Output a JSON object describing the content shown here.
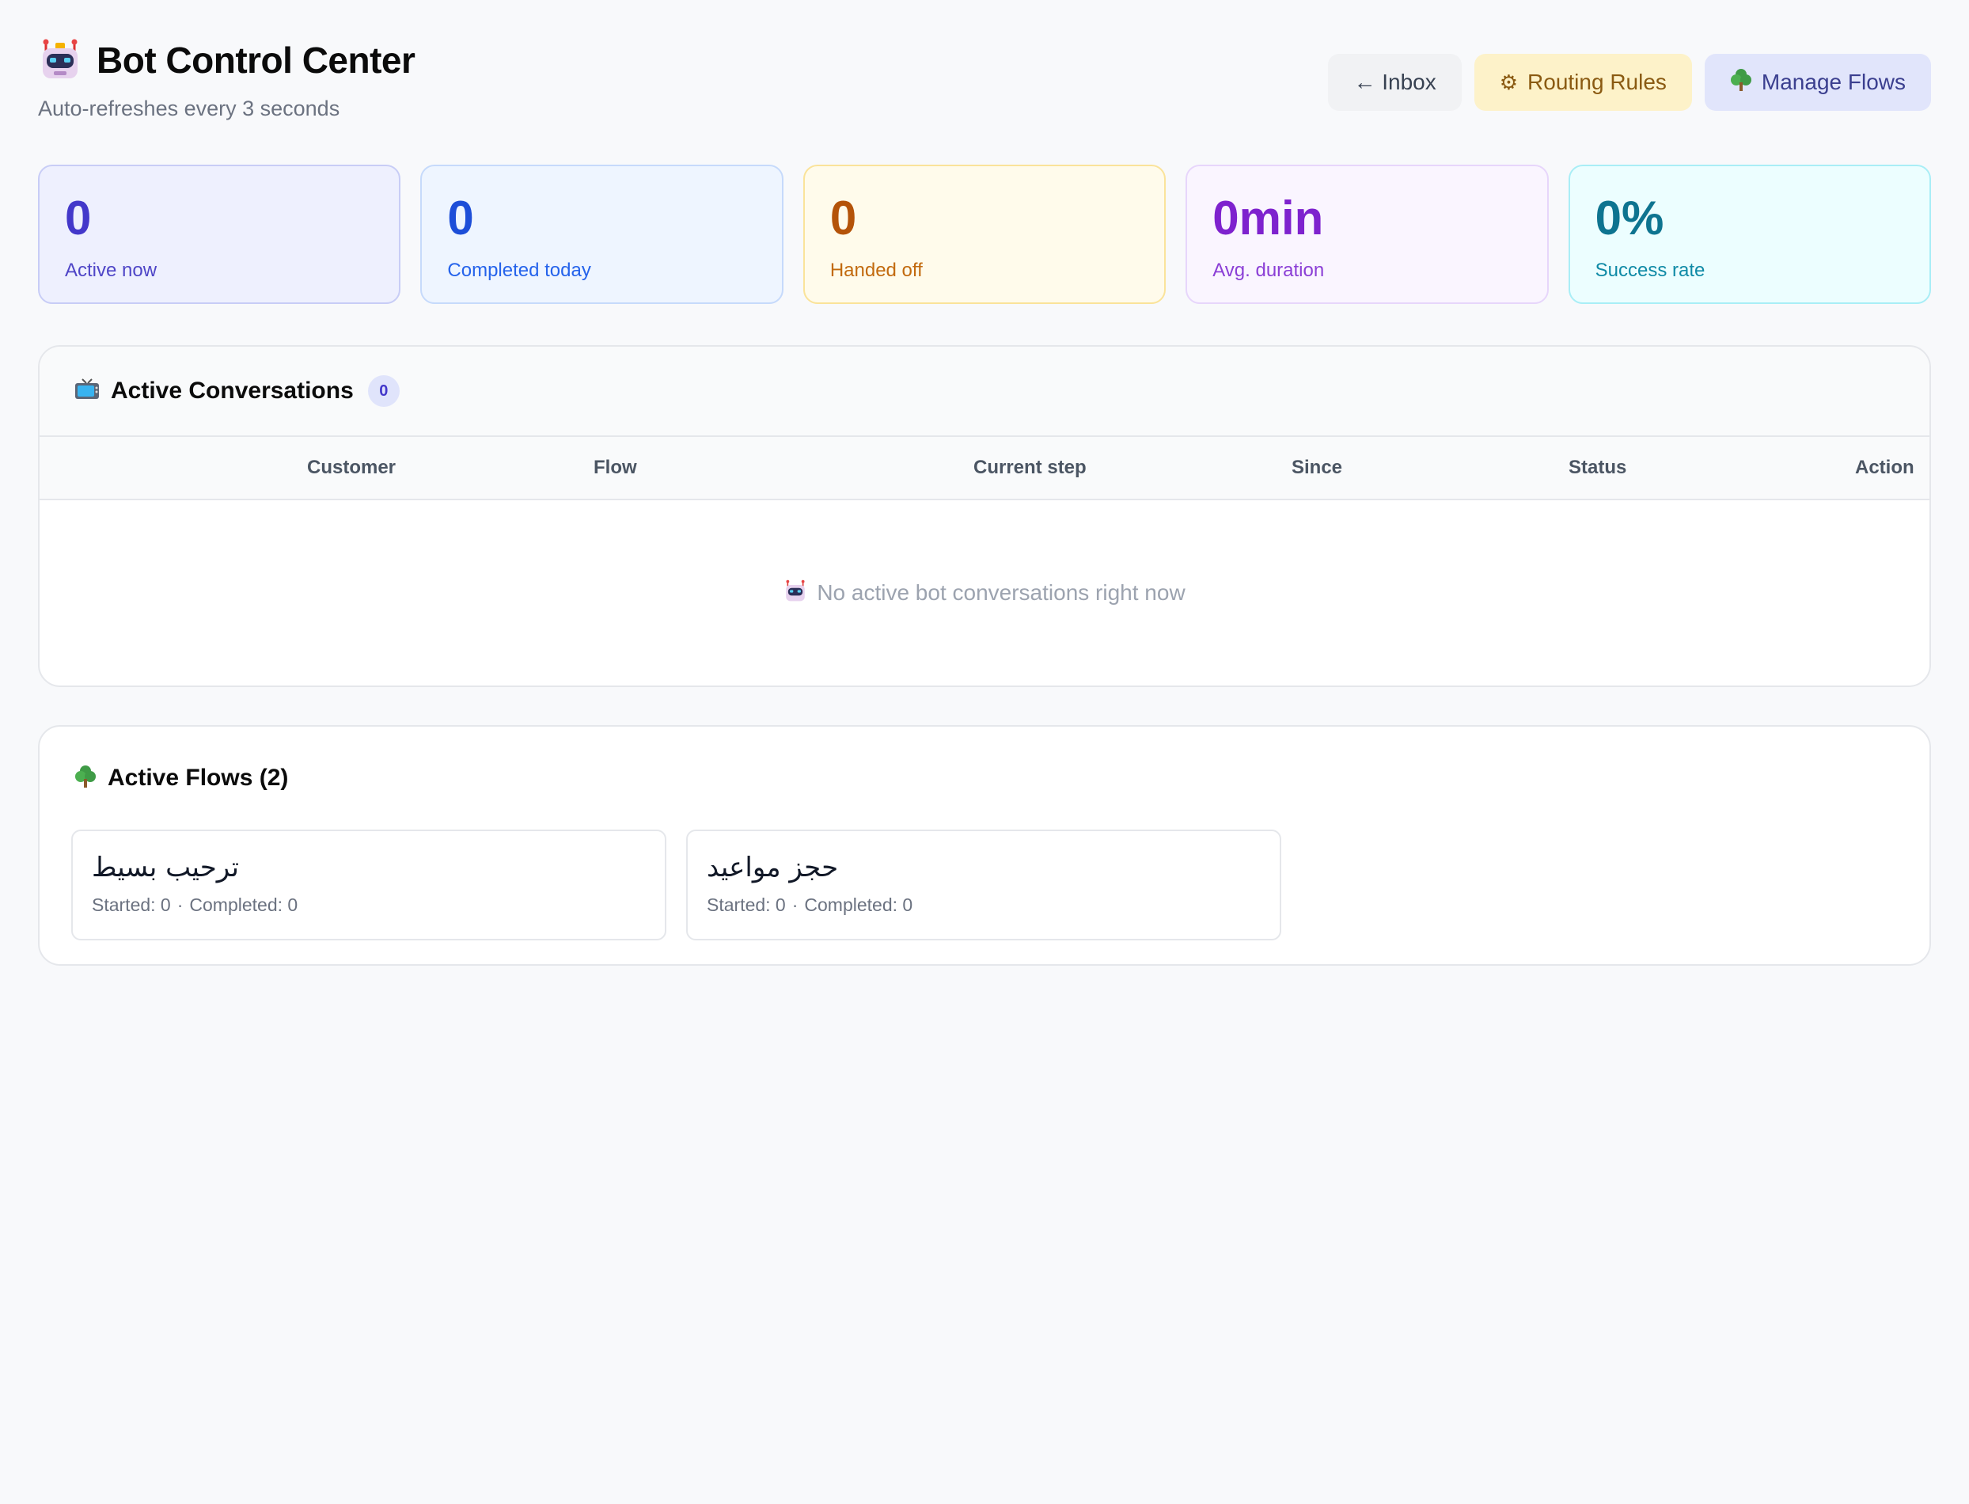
{
  "header": {
    "title": "Bot Control Center",
    "subtitle": "Auto-refreshes every 3 seconds",
    "icon": "robot-icon",
    "buttons": {
      "inbox": "← Inbox",
      "routing": "Routing Rules",
      "flows": "Manage Flows"
    }
  },
  "stats": [
    {
      "value": "0",
      "label": "Active now"
    },
    {
      "value": "0",
      "label": "Completed today"
    },
    {
      "value": "0",
      "label": "Handed off"
    },
    {
      "value": "0min",
      "label": "Avg. duration"
    },
    {
      "value": "0%",
      "label": "Success rate"
    }
  ],
  "conversations": {
    "title": "Active Conversations",
    "count": "0",
    "icon": "tv-icon",
    "columns": [
      "Customer",
      "Flow",
      "Current step",
      "Since",
      "Status",
      "Action"
    ],
    "empty_message": "No active bot conversations right now"
  },
  "flows": {
    "title": "Active Flows (2)",
    "icon": "tree-icon",
    "items": [
      {
        "name": "ترحيب بسيط",
        "started": "Started: 0",
        "completed": "Completed: 0"
      },
      {
        "name": "حجز مواعيد",
        "started": "Started: 0",
        "completed": "Completed: 0"
      }
    ]
  },
  "colors": {
    "background": "#f8f9fb",
    "accent": "#4338ca",
    "routing_button": "#fdf2c9",
    "flows_button": "#e1e5fb"
  }
}
